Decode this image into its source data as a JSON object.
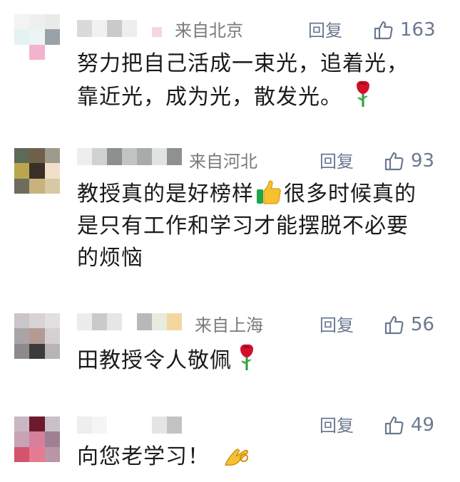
{
  "comments": [
    {
      "location": "来自北京",
      "reply_label": "回复",
      "likes": "163",
      "lines": [
        "努力把自己活成一束光，追着光，",
        "靠近光，成为光，散发光。"
      ],
      "emoji": "rose"
    },
    {
      "location": "来自河北",
      "reply_label": "回复",
      "likes": "93",
      "lines": [
        "教授真的是好榜样",
        "很多时候真的",
        "是只有工作和学习才能摆脱不必要",
        "的烦恼"
      ],
      "emoji": "thumbs-up"
    },
    {
      "location": "来自上海",
      "reply_label": "回复",
      "likes": "56",
      "lines": [
        "田教授令人敬佩"
      ],
      "emoji": "rose"
    },
    {
      "location": "",
      "reply_label": "回复",
      "likes": "49",
      "lines": [
        "向您老学习！"
      ],
      "emoji": "ok-hand"
    }
  ],
  "colors": {
    "location_text": "#7a7a7a",
    "action_text": "#6b7890",
    "body_text": "#1a1a1a"
  }
}
